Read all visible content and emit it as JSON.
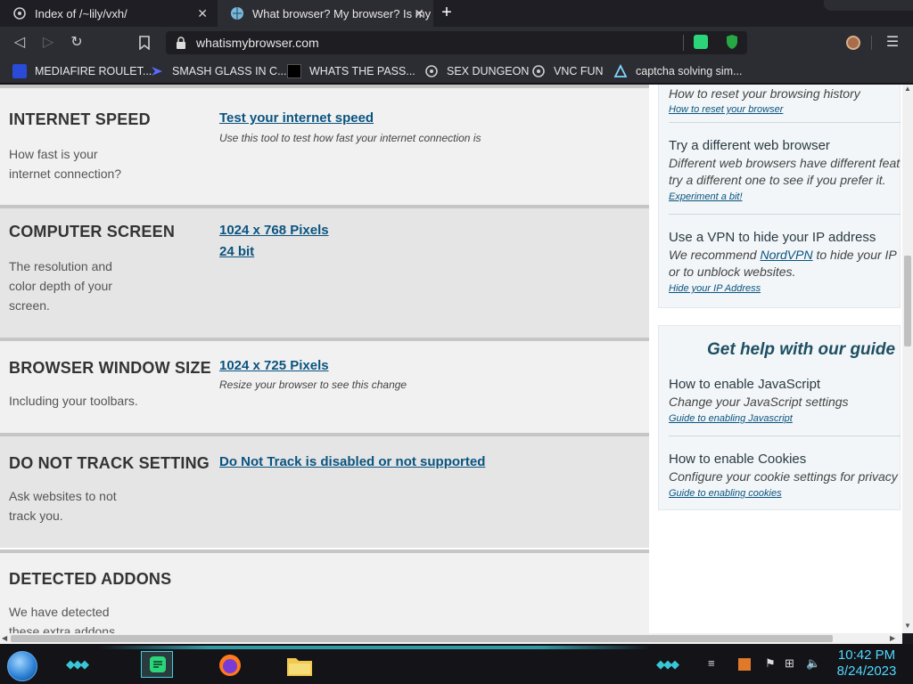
{
  "tabs": [
    {
      "title": "Index of /~lily/vxh/",
      "close": "✕"
    },
    {
      "title": "What browser? My browser? Is my",
      "close": "✕"
    }
  ],
  "newtab": "+",
  "toolbar": {
    "url": "whatismybrowser.com",
    "back": "◁",
    "forward": "▷",
    "reload": "↻",
    "bookmark": "⌑",
    "menu": "☰"
  },
  "bookmarks": [
    {
      "label": "MEDIAFIRE ROULET...",
      "icon": "mediafire-icon"
    },
    {
      "label": "SMASH GLASS IN C...",
      "icon": "smash-icon"
    },
    {
      "label": "WHATS THE PASS...",
      "icon": "pass-icon"
    },
    {
      "label": "SEX DUNGEON",
      "icon": "dungeon-icon"
    },
    {
      "label": "VNC FUN",
      "icon": "vnc-icon"
    },
    {
      "label": "captcha solving sim...",
      "icon": "captcha-icon"
    }
  ],
  "sections": {
    "speed": {
      "title": "INTERNET SPEED",
      "desc": "How fast is your internet connection?",
      "link": "Test your internet speed",
      "note": "Use this tool to test how fast your internet connection is"
    },
    "screen": {
      "title": "COMPUTER SCREEN",
      "desc": "The resolution and color depth of your screen.",
      "link1": "1024 x 768 Pixels",
      "link2": "24 bit"
    },
    "window": {
      "title": "BROWSER WINDOW SIZE",
      "desc": "Including your toolbars.",
      "link": "1024 x 725 Pixels",
      "note": "Resize your browser to see this change"
    },
    "dnt": {
      "title": "DO NOT TRACK SETTING",
      "desc": "Ask websites to not track you.",
      "link": "Do Not Track is disabled or not supported"
    },
    "addons": {
      "title": "DETECTED ADDONS",
      "desc": "We have detected these extra addons"
    }
  },
  "sidebar": {
    "reset": {
      "title": "How to reset your browsing history",
      "link": "How to reset your browser"
    },
    "different": {
      "title": "Try a different web browser",
      "desc1": "Different web browsers have different feat",
      "desc2": "try a different one to see if you prefer it.",
      "link": "Experiment a bit!"
    },
    "vpn": {
      "title": "Use a VPN to hide your IP address",
      "desc_pre": "We recommend ",
      "desc_link": "NordVPN",
      "desc_post": " to hide your IP",
      "desc2": "or to unblock websites.",
      "link": "Hide your IP Address"
    },
    "guide_heading": "Get help with our guide",
    "js": {
      "title": "How to enable JavaScript",
      "desc": "Change your JavaScript settings",
      "link": "Guide to enabling Javascript"
    },
    "cookies": {
      "title": "How to enable Cookies",
      "desc": "Configure your cookie settings for privacy",
      "link": "Guide to enabling cookies"
    }
  },
  "taskbar": {
    "time": "10:42 PM",
    "date": "8/24/2023"
  },
  "colors": {
    "link": "#0a5480",
    "accent": "#3fd0e0",
    "clock": "#4fd8ff"
  }
}
